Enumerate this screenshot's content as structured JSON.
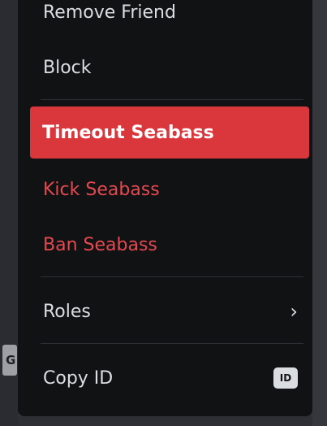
{
  "menu": {
    "remove_friend": "Remove Friend",
    "block": "Block",
    "timeout": "Timeout Seabass",
    "kick": "Kick Seabass",
    "ban": "Ban Seabass",
    "roles": "Roles",
    "roles_chevron": "›",
    "copy_id": "Copy ID",
    "id_badge": "ID"
  },
  "background": {
    "peek_text": "G"
  },
  "colors": {
    "menu_bg": "#111214",
    "danger": "#e5494f",
    "focused_bg": "#da373c"
  }
}
